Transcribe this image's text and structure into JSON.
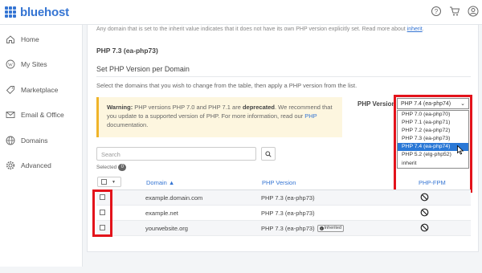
{
  "header": {
    "brand": "bluehost",
    "icons": [
      "help-icon",
      "cart-icon",
      "account-icon"
    ]
  },
  "sidebar": {
    "items": [
      {
        "label": "Home",
        "icon": "home-icon"
      },
      {
        "label": "My Sites",
        "icon": "wordpress-icon"
      },
      {
        "label": "Marketplace",
        "icon": "tag-icon"
      },
      {
        "label": "Email & Office",
        "icon": "mail-icon"
      },
      {
        "label": "Domains",
        "icon": "globe-icon"
      },
      {
        "label": "Advanced",
        "icon": "gear-icon"
      }
    ]
  },
  "main": {
    "note_text": "Any domain that is set to the inherit value indicates that it does not have its own PHP version explicitly set. Read more about ",
    "note_link": "inherit",
    "note_end": ".",
    "current_version": "PHP 7.3 (ea-php73)",
    "section_title": "Set PHP Version per Domain",
    "instructions": "Select the domains that you wish to change from the table, then apply a PHP version from the list.",
    "warning": {
      "bold": "Warning:",
      "text1": " PHP versions PHP 7.0 and PHP 7.1 are ",
      "bold2": "deprecated",
      "text2": ". We recommend that you update to a supported version of PHP. For more information, read our ",
      "link": "PHP",
      "text3": " documentation."
    },
    "php_version_label": "PHP Version",
    "selected_version": "PHP 7.4 (ea-php74)",
    "dropdown_options": [
      "PHP 7.0 (ea-php70)",
      "PHP 7.1 (ea-php71)",
      "PHP 7.2 (ea-php72)",
      "PHP 7.3 (ea-php73)",
      "PHP 7.4 (ea-php74)",
      "PHP 5.2 (elg-php52)",
      "inherit"
    ],
    "highlighted_option": "PHP 7.4 (ea-php74)",
    "search_placeholder": "Search",
    "selected_label": "Selected",
    "selected_count": "0",
    "table": {
      "headers": {
        "domain": "Domain ▲",
        "php_version": "PHP Version",
        "php_fpm": "PHP-FPM"
      },
      "rows": [
        {
          "domain": "example.domain.com",
          "version": "PHP 7.3 (ea-php73)",
          "inherited": ""
        },
        {
          "domain": "example.net",
          "version": "PHP 7.3 (ea-php73)",
          "inherited": ""
        },
        {
          "domain": "yourwebsite.org",
          "version": "PHP 7.3 (ea-php73)",
          "inherited": "Inherited"
        }
      ]
    }
  },
  "colors": {
    "brand": "#3575d3",
    "highlight": "#e3131b",
    "selected_option": "#2a78d6",
    "warning_bg": "#fdf6df"
  }
}
